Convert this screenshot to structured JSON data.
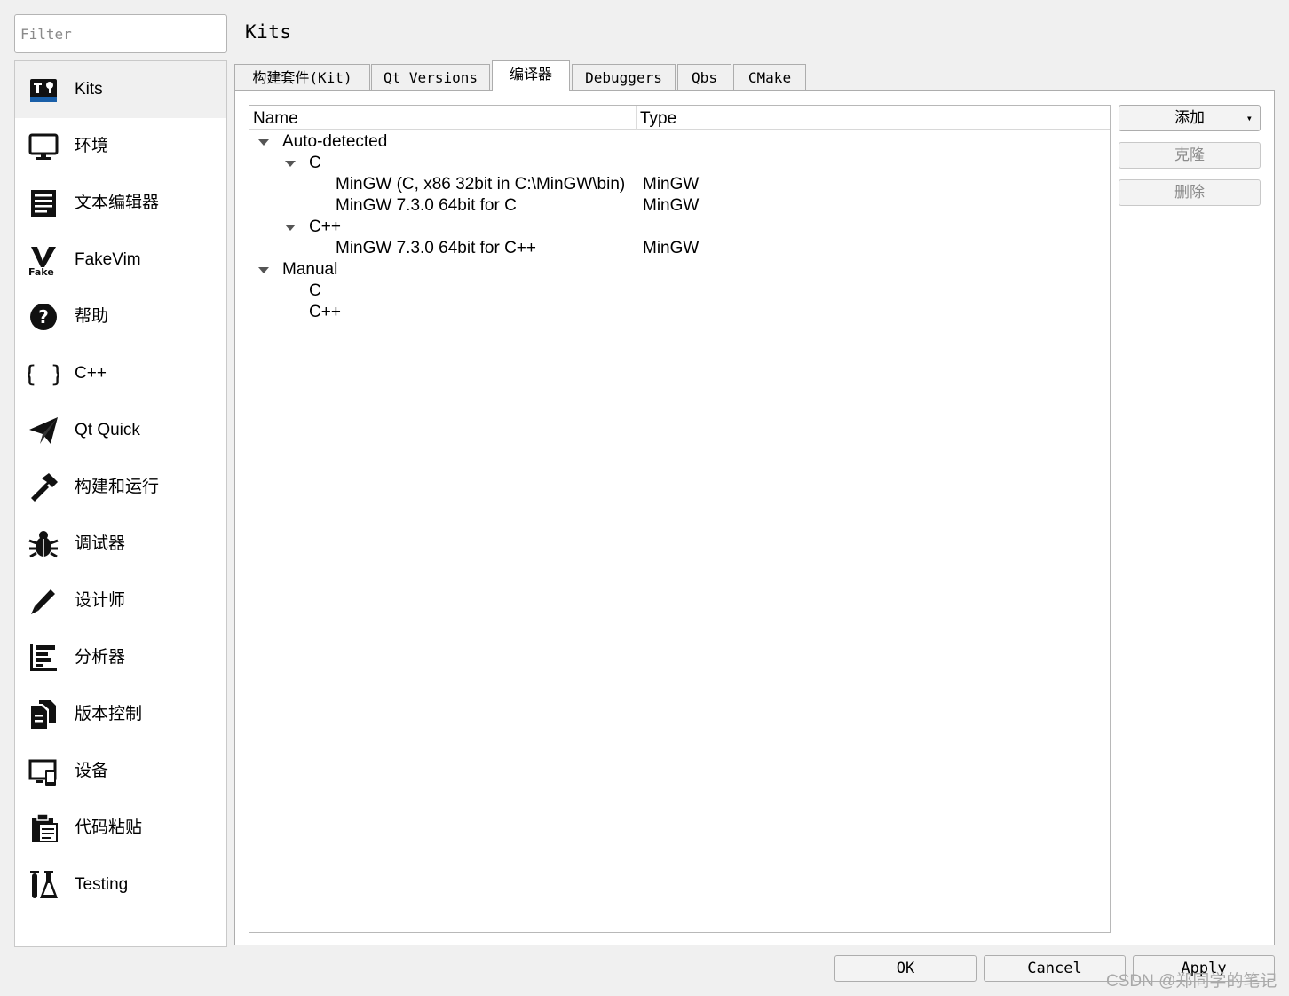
{
  "filter": {
    "placeholder": "Filter",
    "value": ""
  },
  "page_title": "Kits",
  "sidebar": {
    "items": [
      {
        "label": "Kits",
        "icon": "kits-icon",
        "selected": true
      },
      {
        "label": "环境",
        "icon": "monitor-icon"
      },
      {
        "label": "文本编辑器",
        "icon": "text-editor-icon"
      },
      {
        "label": "FakeVim",
        "icon": "fakevim-icon"
      },
      {
        "label": "帮助",
        "icon": "help-icon"
      },
      {
        "label": "C++",
        "icon": "braces-icon"
      },
      {
        "label": "Qt Quick",
        "icon": "paper-plane-icon"
      },
      {
        "label": "构建和运行",
        "icon": "hammer-icon"
      },
      {
        "label": "调试器",
        "icon": "bug-icon"
      },
      {
        "label": "设计师",
        "icon": "pen-icon"
      },
      {
        "label": "分析器",
        "icon": "analyzer-icon"
      },
      {
        "label": "版本控制",
        "icon": "version-control-icon"
      },
      {
        "label": "设备",
        "icon": "device-icon"
      },
      {
        "label": "代码粘贴",
        "icon": "clipboard-icon"
      },
      {
        "label": "Testing",
        "icon": "test-tube-icon"
      }
    ]
  },
  "tabs": [
    {
      "label": "构建套件(Kit)"
    },
    {
      "label": "Qt Versions"
    },
    {
      "label": "编译器",
      "active": true
    },
    {
      "label": "Debuggers"
    },
    {
      "label": "Qbs"
    },
    {
      "label": "CMake"
    }
  ],
  "tree": {
    "columns": {
      "name": "Name",
      "type": "Type"
    },
    "rows": [
      {
        "name": "Auto-detected",
        "type": "",
        "level": 0,
        "expanded": true
      },
      {
        "name": "C",
        "type": "",
        "level": 1,
        "expanded": true
      },
      {
        "name": "MinGW (C, x86 32bit in C:\\MinGW\\bin)",
        "type": "MinGW",
        "level": 2
      },
      {
        "name": "MinGW 7.3.0 64bit for C",
        "type": "MinGW",
        "level": 2
      },
      {
        "name": "C++",
        "type": "",
        "level": 1,
        "expanded": true
      },
      {
        "name": "MinGW 7.3.0 64bit for C++",
        "type": "MinGW",
        "level": 2
      },
      {
        "name": "Manual",
        "type": "",
        "level": 0,
        "expanded": true
      },
      {
        "name": "C",
        "type": "",
        "level": 1
      },
      {
        "name": "C++",
        "type": "",
        "level": 1
      }
    ]
  },
  "actions": {
    "add": "添加",
    "clone": "克隆",
    "remove": "删除"
  },
  "footer": {
    "ok": "OK",
    "cancel": "Cancel",
    "apply": "Apply"
  },
  "watermark": "CSDN @郑同学的笔记"
}
